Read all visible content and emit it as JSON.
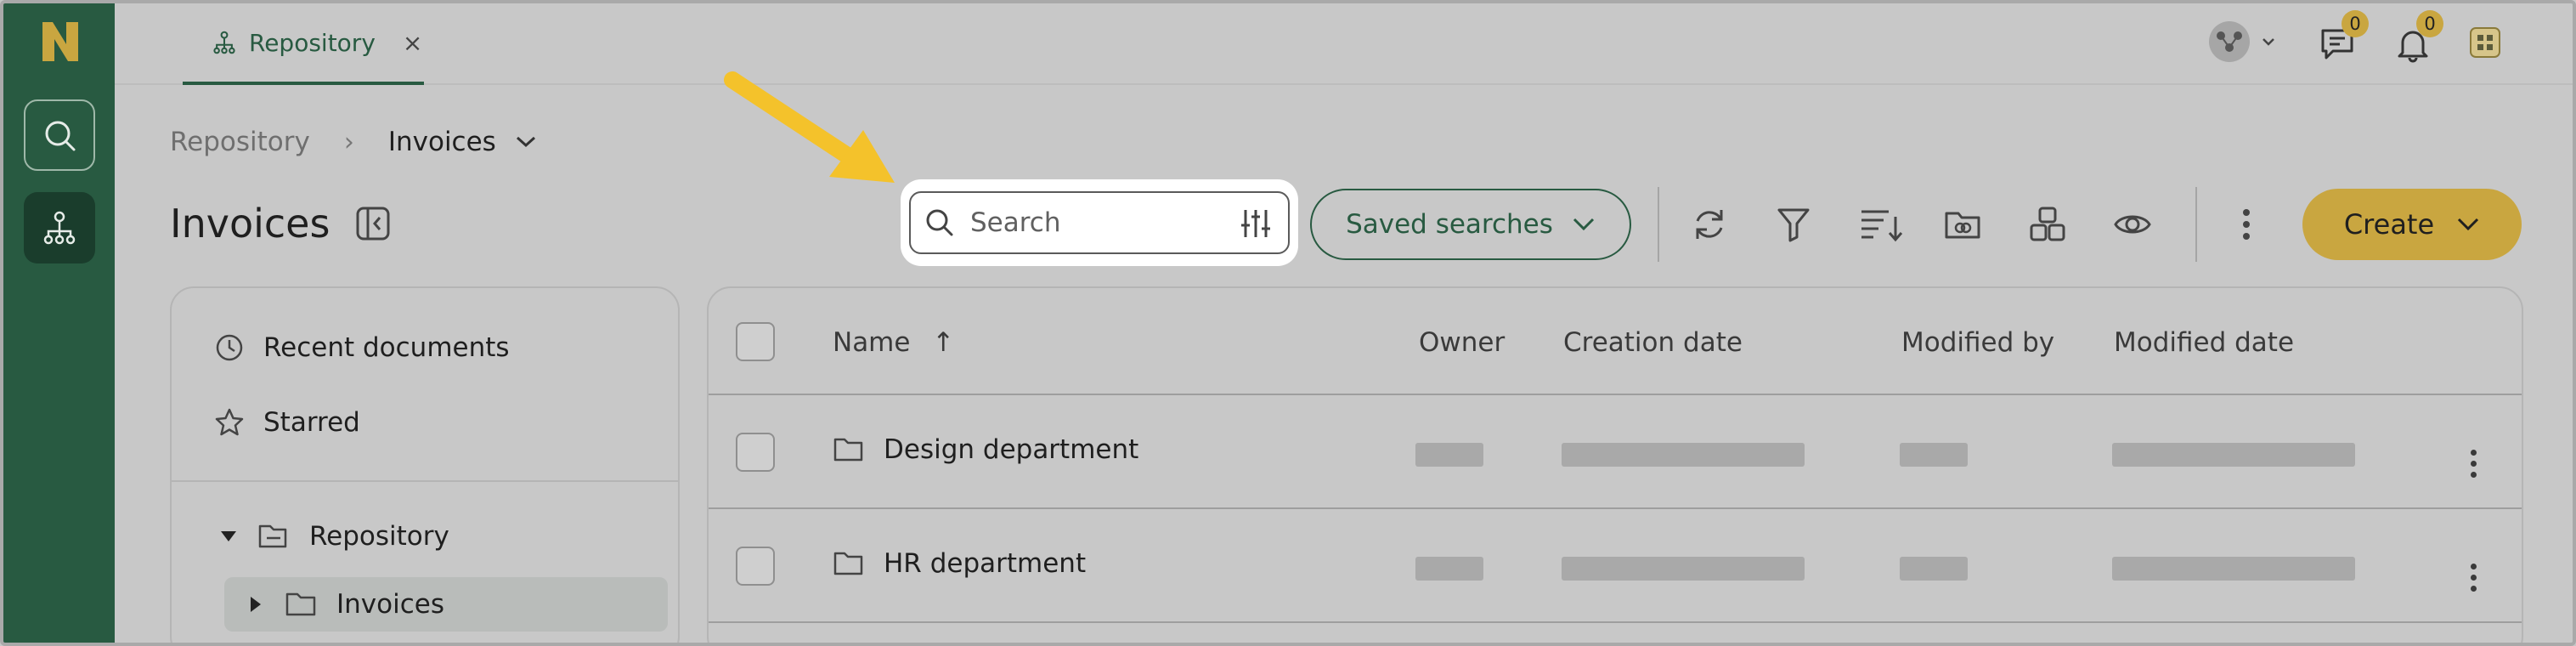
{
  "topbar": {
    "tab_label": "Repository",
    "tab_close": "×",
    "messages_badge": "0",
    "notifications_badge": "0"
  },
  "breadcrumb": {
    "root": "Repository",
    "separator": "›",
    "current": "Invoices"
  },
  "page": {
    "title": "Invoices"
  },
  "toolbar": {
    "search_placeholder": "Search",
    "saved_searches_label": "Saved searches",
    "create_label": "Create"
  },
  "sidebar": {
    "recent_label": "Recent documents",
    "starred_label": "Starred",
    "tree": [
      {
        "label": "Repository",
        "expanded": true
      },
      {
        "label": "Invoices",
        "expanded": false,
        "selected": true
      }
    ]
  },
  "table": {
    "columns": [
      "Name",
      "Owner",
      "Creation date",
      "Modified by",
      "Modified date"
    ],
    "sort_indicator": "↑",
    "rows": [
      {
        "name": "Design department"
      },
      {
        "name": "HR department"
      }
    ]
  },
  "colors": {
    "brand_green": "#285a41",
    "accent_gold": "#c9a640",
    "annotation_arrow": "#f4c22b"
  }
}
